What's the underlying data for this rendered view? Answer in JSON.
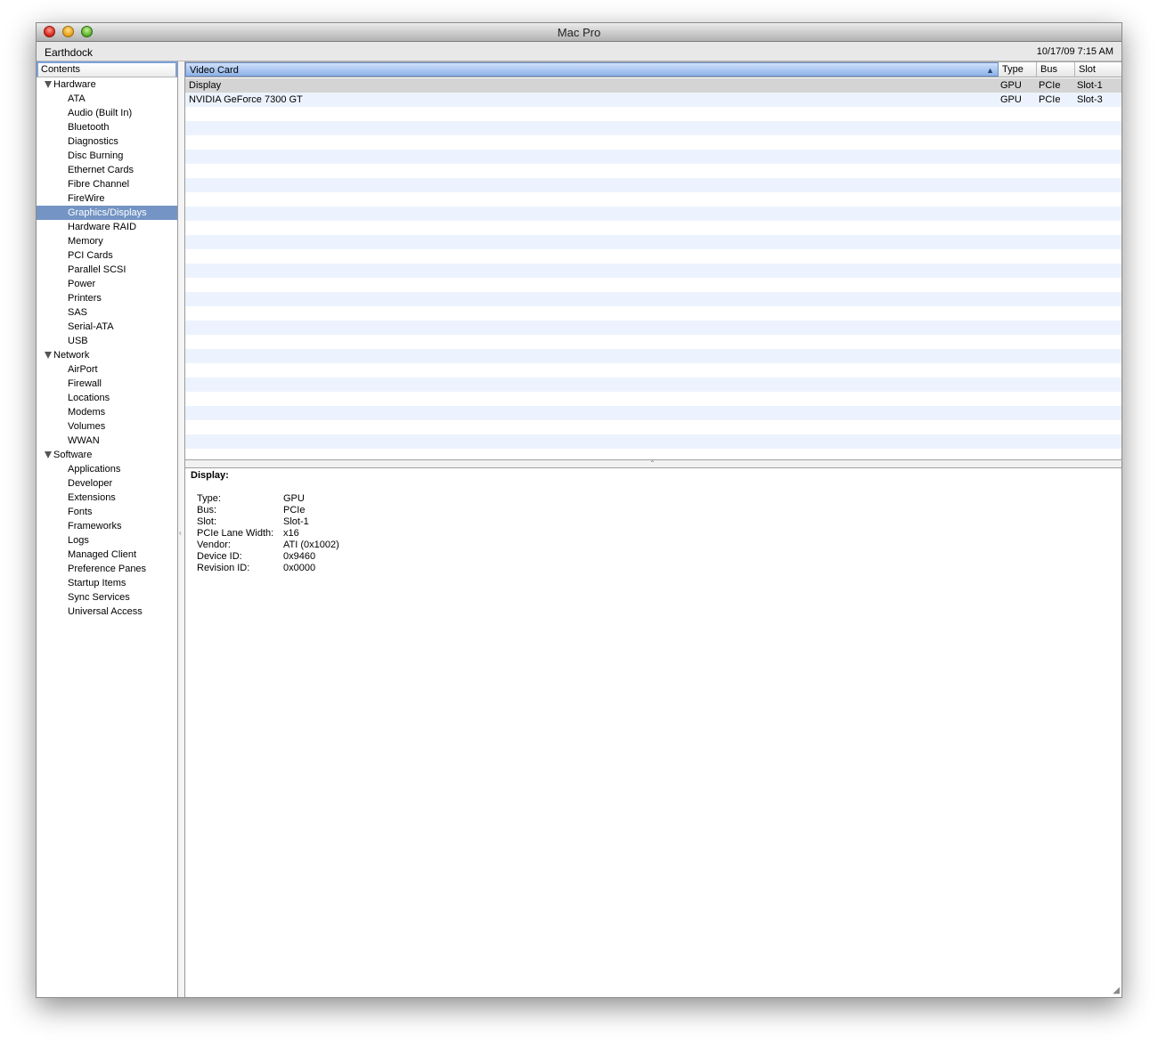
{
  "window": {
    "title": "Mac Pro"
  },
  "infobar": {
    "computer_name": "Earthdock",
    "date": "10/17/09 7:15 AM"
  },
  "sidebar": {
    "header": "Contents",
    "groups": [
      {
        "label": "Hardware",
        "items": [
          "ATA",
          "Audio (Built In)",
          "Bluetooth",
          "Diagnostics",
          "Disc Burning",
          "Ethernet Cards",
          "Fibre Channel",
          "FireWire",
          "Graphics/Displays",
          "Hardware RAID",
          "Memory",
          "PCI Cards",
          "Parallel SCSI",
          "Power",
          "Printers",
          "SAS",
          "Serial-ATA",
          "USB"
        ]
      },
      {
        "label": "Network",
        "items": [
          "AirPort",
          "Firewall",
          "Locations",
          "Modems",
          "Volumes",
          "WWAN"
        ]
      },
      {
        "label": "Software",
        "items": [
          "Applications",
          "Developer",
          "Extensions",
          "Fonts",
          "Frameworks",
          "Logs",
          "Managed Client",
          "Preference Panes",
          "Startup Items",
          "Sync Services",
          "Universal Access"
        ]
      }
    ],
    "selected": "Graphics/Displays"
  },
  "table": {
    "columns": {
      "name": "Video Card",
      "type": "Type",
      "bus": "Bus",
      "slot": "Slot"
    },
    "sort_indicator": "▲",
    "rows": [
      {
        "name": "Display",
        "type": "GPU",
        "bus": "PCIe",
        "slot": "Slot-1"
      },
      {
        "name": "NVIDIA GeForce 7300 GT",
        "type": "GPU",
        "bus": "PCIe",
        "slot": "Slot-3"
      }
    ]
  },
  "detail": {
    "title": "Display:",
    "fields": [
      {
        "key": "Type:",
        "value": "GPU"
      },
      {
        "key": "Bus:",
        "value": "PCIe"
      },
      {
        "key": "Slot:",
        "value": "Slot-1"
      },
      {
        "key": "PCIe Lane Width:",
        "value": "x16"
      },
      {
        "key": "Vendor:",
        "value": "ATI (0x1002)"
      },
      {
        "key": "Device ID:",
        "value": "0x9460"
      },
      {
        "key": "Revision ID:",
        "value": "0x0000"
      }
    ]
  }
}
